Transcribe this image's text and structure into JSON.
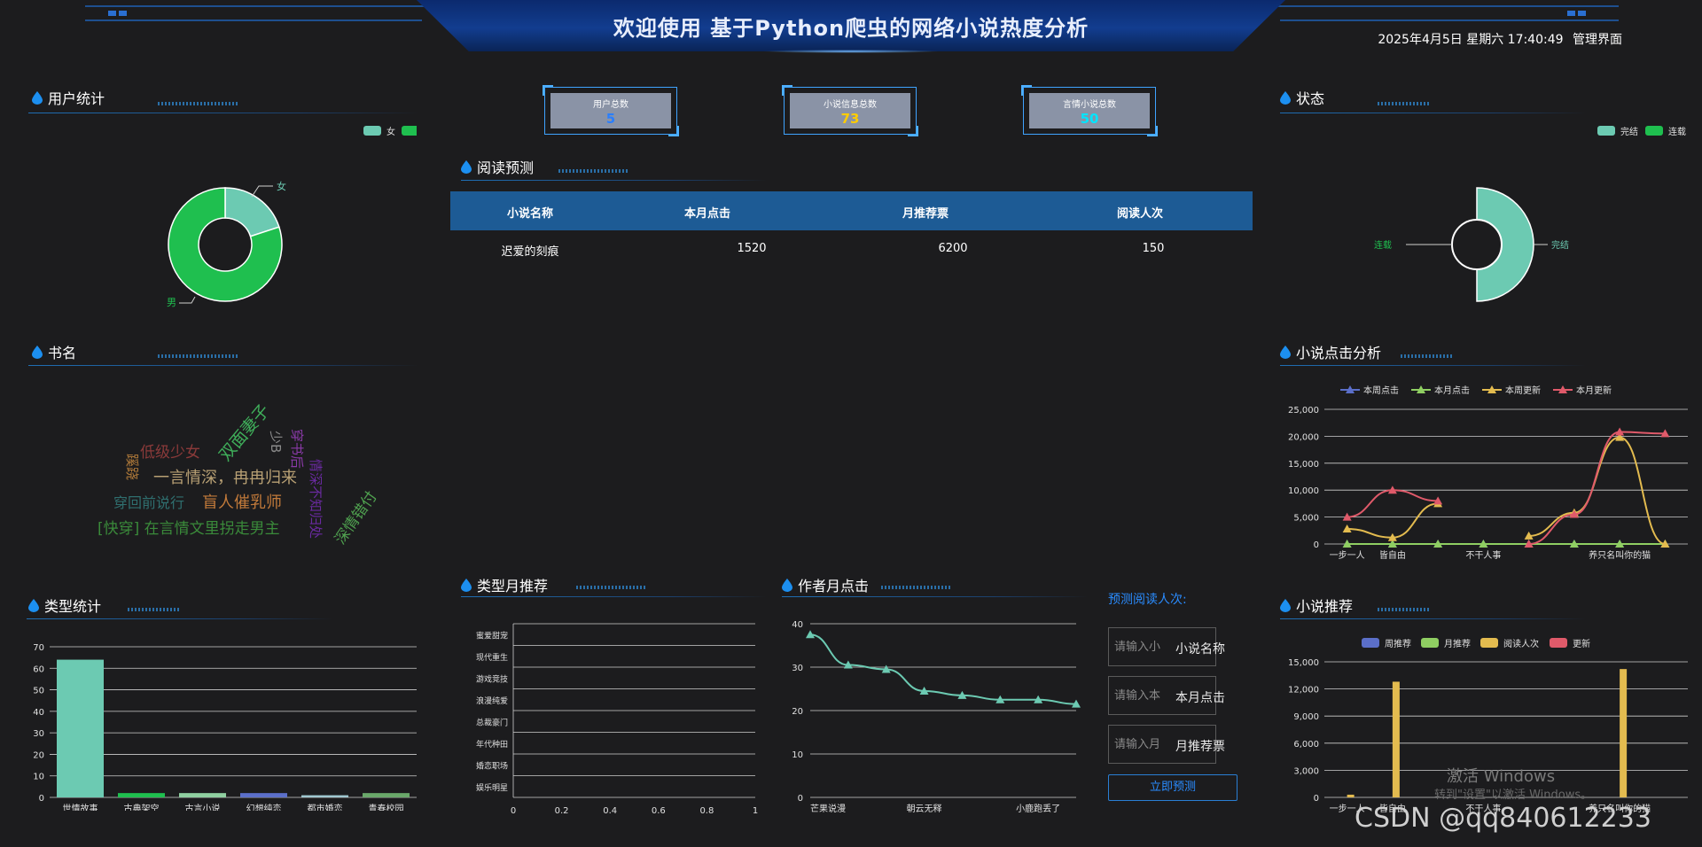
{
  "header": {
    "title": "欢迎使用 基于Python爬虫的网络小说热度分析",
    "datetime": "2025年4月5日 星期六 17:40:49",
    "admin_link": "管理界面"
  },
  "panels": {
    "user_stats": "用户统计",
    "status": "状态",
    "read_predict": "阅读预测",
    "book_name": "书名",
    "click_analysis": "小说点击分析",
    "type_stats": "类型统计",
    "type_monthly": "类型月推荐",
    "author_monthly": "作者月点击",
    "recommend": "小说推荐"
  },
  "stats": [
    {
      "label": "用户总数",
      "value": "5",
      "color": "#2a7fff"
    },
    {
      "label": "小说信息总数",
      "value": "73",
      "color": "#ffcc00"
    },
    {
      "label": "言情小说总数",
      "value": "50",
      "color": "#00e5ff"
    }
  ],
  "table": {
    "headers": [
      "小说名称",
      "本月点击",
      "月推荐票",
      "阅读人次"
    ],
    "rows": [
      [
        "迟爱的刻痕",
        "1520",
        "6200",
        "150"
      ]
    ]
  },
  "form": {
    "title": "预测阅读人次:",
    "inputs": [
      {
        "placeholder": "请输入小",
        "value": "小说名称"
      },
      {
        "placeholder": "请输入本",
        "value": "本月点击"
      },
      {
        "placeholder": "请输入月",
        "value": "月推荐票"
      }
    ],
    "button": "立即预测"
  },
  "wordcloud": [
    {
      "text": "低级少女",
      "color": "#8b3a3a"
    },
    {
      "text": "双面妻子",
      "color": "#3fae5a"
    },
    {
      "text": "少B",
      "color": "#8a8a8a"
    },
    {
      "text": "穿书后",
      "color": "#8a3aa8"
    },
    {
      "text": "蹊跷",
      "color": "#b07a3a"
    },
    {
      "text": "一言情深，冉冉归来",
      "color": "#b8a074"
    },
    {
      "text": "穿回前说行",
      "color": "#2f6f6f"
    },
    {
      "text": "盲人催乳师",
      "color": "#c27a3a"
    },
    {
      "text": "情深不知归处",
      "color": "#6a2aa0"
    },
    {
      "text": "[快穿] 在言情文里拐走男主",
      "color": "#3a8a3a"
    },
    {
      "text": "深情错付",
      "color": "#4fa04f"
    }
  ],
  "watermark": {
    "line1": "激活 Windows",
    "line2": "转到\"设置\"以激活 Windows。",
    "csdn": "CSDN @qq840612233"
  },
  "chart_data": [
    {
      "id": "user_gender",
      "type": "pie",
      "legend": [
        "女",
        "男"
      ],
      "labels": [
        "女",
        "男"
      ],
      "values": [
        1,
        4
      ],
      "colors": [
        "#6ccab2",
        "#1fbf4f"
      ],
      "legend_position": "top-right"
    },
    {
      "id": "status",
      "type": "pie",
      "legend": [
        "完结",
        "连载"
      ],
      "labels": [
        "完结",
        "连载"
      ],
      "values": [
        1,
        0
      ],
      "colors": [
        "#6ccab2",
        "#1fbf4f"
      ],
      "legend_position": "top-right"
    },
    {
      "id": "click_analysis",
      "type": "line",
      "legend": [
        "本周点击",
        "本月点击",
        "本周更新",
        "本月更新"
      ],
      "categories": [
        "一步一人",
        "皆自由",
        "",
        "不干人事",
        "",
        "",
        "养只名叫你的猫",
        ""
      ],
      "y_ticks": [
        "0",
        "5,000",
        "10,000",
        "15,000",
        "20,000",
        "25,000"
      ],
      "ylim": [
        0,
        25000
      ],
      "series": [
        {
          "name": "本周点击",
          "color": "#5b6fc9",
          "values": [
            0,
            0,
            0,
            0,
            0,
            0,
            0,
            0
          ]
        },
        {
          "name": "本月点击",
          "color": "#8fce62",
          "values": [
            0,
            0,
            0,
            0,
            0,
            0,
            0,
            0
          ]
        },
        {
          "name": "本周更新",
          "color": "#e3bb4f",
          "values": [
            2800,
            1200,
            7500,
            null,
            1500,
            5800,
            19800,
            0
          ]
        },
        {
          "name": "本月更新",
          "color": "#e05a6a",
          "values": [
            5000,
            10000,
            8000,
            null,
            0,
            5500,
            20800,
            20500
          ]
        }
      ],
      "legend_position": "top"
    },
    {
      "id": "type_stats",
      "type": "bar",
      "categories": [
        "世情故事",
        "古典架空",
        "古言小说",
        "幻想纯恋",
        "都市婚恋",
        "青春校园"
      ],
      "values": [
        64,
        2,
        2,
        2,
        1,
        2
      ],
      "colors": [
        "#6ccab2",
        "#1fbf4f",
        "#8fcfa0",
        "#5b6fc9",
        "#a0c8d0",
        "#6aa86a"
      ],
      "y_ticks": [
        "0",
        "10",
        "20",
        "30",
        "40",
        "50",
        "60",
        "70"
      ],
      "ylim": [
        0,
        70
      ]
    },
    {
      "id": "type_monthly",
      "type": "bar",
      "orientation": "horizontal",
      "categories": [
        "娱乐明星",
        "婚恋职场",
        "年代种田",
        "总裁豪门",
        "浪漫纯爱",
        "游戏竞技",
        "现代重生",
        "蜜爱甜宠"
      ],
      "values": [
        0,
        0,
        0,
        0,
        0,
        0,
        0,
        0
      ],
      "x_ticks": [
        "0",
        "0.2",
        "0.4",
        "0.6",
        "0.8",
        "1"
      ],
      "xlim": [
        0,
        1
      ]
    },
    {
      "id": "author_monthly",
      "type": "line",
      "categories": [
        "芒果说漫",
        "",
        "",
        "朝云无释",
        "",
        "",
        "小鹿跑丢了",
        ""
      ],
      "values": [
        37.5,
        30.5,
        29.5,
        24.5,
        23.5,
        22.5,
        22.5,
        21.5
      ],
      "color": "#6ccab2",
      "y_ticks": [
        "0",
        "10",
        "20",
        "30",
        "40"
      ],
      "ylim": [
        0,
        40
      ]
    },
    {
      "id": "recommend",
      "type": "bar",
      "legend": [
        "周推荐",
        "月推荐",
        "阅读人次",
        "更新"
      ],
      "categories": [
        "一步一人",
        "皆自由",
        "",
        "不干人事",
        "",
        "",
        "养只名叫你的猫",
        ""
      ],
      "series": [
        {
          "name": "周推荐",
          "color": "#5b6fc9",
          "values": [
            0,
            0,
            0,
            0,
            0,
            0,
            0,
            0
          ]
        },
        {
          "name": "月推荐",
          "color": "#8fce62",
          "values": [
            0,
            0,
            0,
            0,
            0,
            0,
            0,
            0
          ]
        },
        {
          "name": "阅读人次",
          "color": "#e3bb4f",
          "values": [
            300,
            12800,
            0,
            0,
            0,
            0,
            14200,
            0
          ]
        },
        {
          "name": "更新",
          "color": "#e05a6a",
          "values": [
            0,
            0,
            0,
            0,
            0,
            0,
            0,
            0
          ]
        }
      ],
      "y_ticks": [
        "0",
        "3,000",
        "6,000",
        "9,000",
        "12,000",
        "15,000"
      ],
      "ylim": [
        0,
        15000
      ],
      "legend_position": "top"
    }
  ]
}
